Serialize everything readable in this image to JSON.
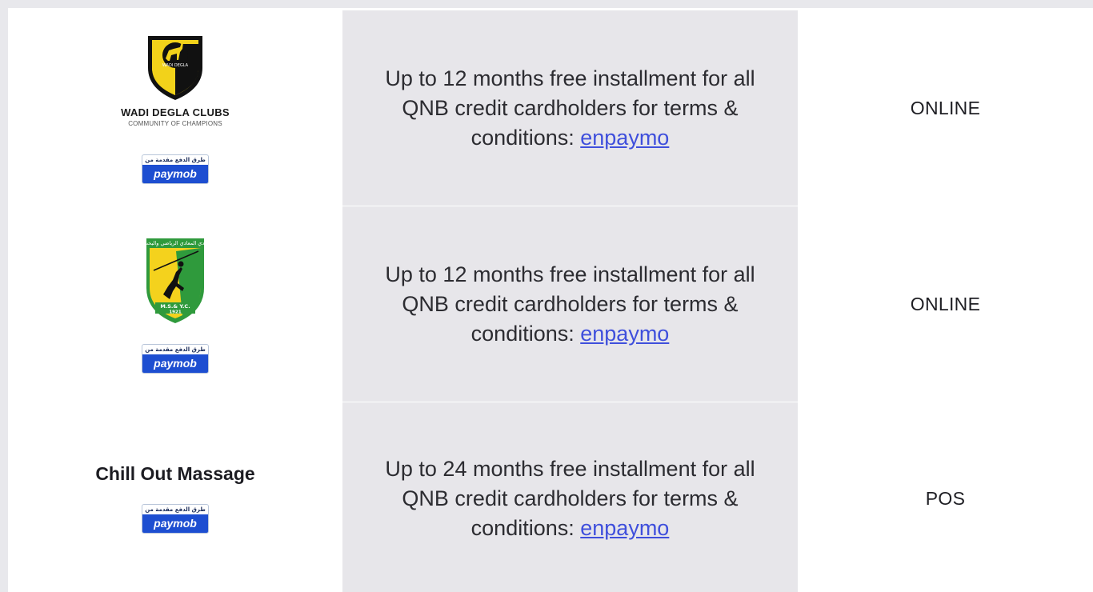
{
  "rows": [
    {
      "merchant_logo_title": "WADI DEGLA CLUBS",
      "merchant_logo_subtitle": "COMMUNITY OF CHAMPIONS",
      "merchant_logo_emblem_text": "WADI DEGLA",
      "badge_arabic": "طرق الدفع مقدمة من",
      "badge_brand": "paymob",
      "desc_prefix": "Up to 12 months free installment for all QNB credit cardholders for terms & conditions: ",
      "desc_link": "enpaymo",
      "channel": "ONLINE"
    },
    {
      "merchant_logo_arabic": "نادي المعادي الرياضي واليخت",
      "merchant_logo_text": "M.S.& Y.C.",
      "merchant_logo_year": "1921",
      "badge_arabic": "طرق الدفع مقدمة من",
      "badge_brand": "paymob",
      "desc_prefix": "Up to 12 months free installment for all QNB credit cardholders for terms & conditions: ",
      "desc_link": "enpaymo",
      "channel": "ONLINE"
    },
    {
      "merchant_name": "Chill Out Massage",
      "badge_arabic": "طرق الدفع مقدمة من",
      "badge_brand": "paymob",
      "desc_prefix": "Up to 24 months free installment for all QNB credit cardholders for terms & conditions: ",
      "desc_link": "enpaymo",
      "channel": "POS"
    }
  ],
  "colors": {
    "page_bg": "#e8e8ec",
    "desc_bg": "#e7e6ea",
    "link": "#3f4fdc",
    "paymob_blue": "#1d4ed1",
    "wadi_yellow": "#f2d21a",
    "maadi_green": "#2f9a3c"
  },
  "icons": [
    "wadi-degla-logo-icon",
    "maadi-club-logo-icon",
    "paymob-badge-icon"
  ]
}
